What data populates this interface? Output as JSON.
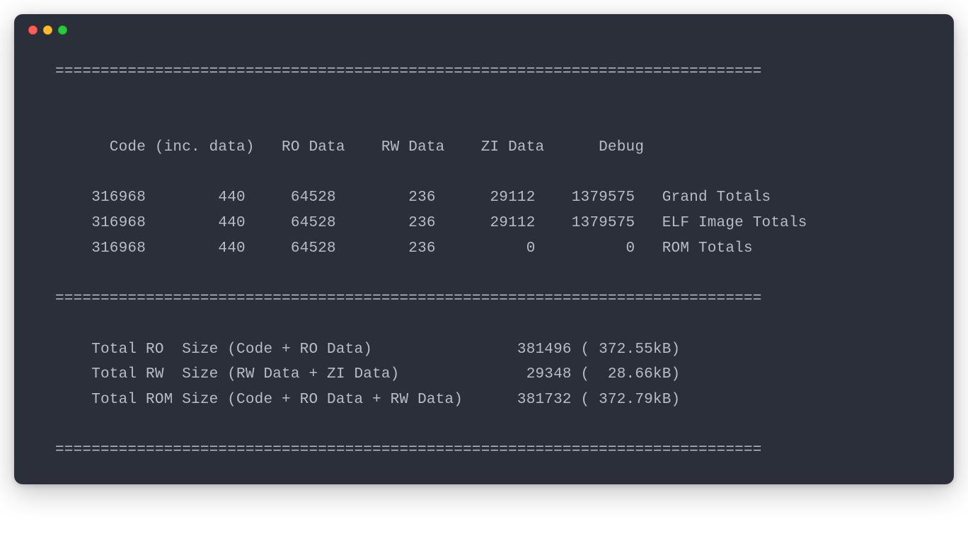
{
  "divider": "==============================================================================",
  "headers": "      Code (inc. data)   RO Data    RW Data    ZI Data      Debug   ",
  "rows": [
    {
      "code": "316968",
      "inc": "440",
      "ro": "64528",
      "rw": "236",
      "zi": "29112",
      "debug": "1379575",
      "label": "Grand Totals"
    },
    {
      "code": "316968",
      "inc": "440",
      "ro": "64528",
      "rw": "236",
      "zi": "29112",
      "debug": "1379575",
      "label": "ELF Image Totals"
    },
    {
      "code": "316968",
      "inc": "440",
      "ro": "64528",
      "rw": "236",
      "zi": "0",
      "debug": "0",
      "label": "ROM Totals"
    }
  ],
  "summary": [
    {
      "label": "Total RO  Size (Code + RO Data)           ",
      "bytes": "381496",
      "human": "372.55kB"
    },
    {
      "label": "Total RW  Size (RW Data + ZI Data)        ",
      "bytes": "29348",
      "human": "28.66kB"
    },
    {
      "label": "Total ROM Size (Code + RO Data + RW Data) ",
      "bytes": "381732",
      "human": "372.79kB"
    }
  ]
}
